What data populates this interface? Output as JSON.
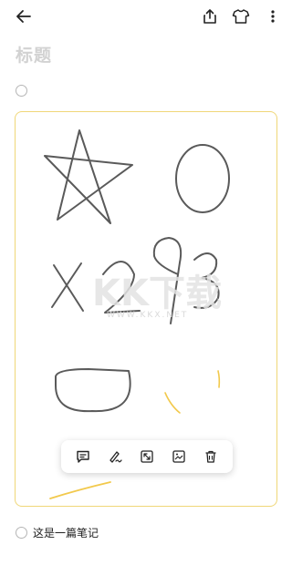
{
  "header": {
    "back_icon": "back-arrow-icon",
    "share_icon": "share-icon",
    "theme_icon": "shirt-icon",
    "more_icon": "more-vertical-icon"
  },
  "note": {
    "title_placeholder": "标题",
    "body_text": "这是一篇笔记"
  },
  "watermark": {
    "logo_text": "KK下载",
    "url": "WWW.KKX.NET"
  },
  "toolbar": {
    "tools": [
      "comment-icon",
      "pen-icon",
      "expand-icon",
      "image-edit-icon",
      "delete-icon"
    ]
  },
  "colors": {
    "card_border": "#f0d778",
    "ink": "#5a5a5a",
    "highlight": "#f2c94c"
  }
}
